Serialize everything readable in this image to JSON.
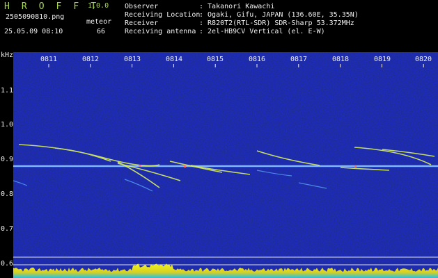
{
  "app": {
    "title": "H R O F F T",
    "version": "1.0.0"
  },
  "file": {
    "name": "2505090810.png",
    "datetime": "25.05.09 08:10"
  },
  "meteor": {
    "label": "meteor",
    "count": "66"
  },
  "info": [
    {
      "label": "Observer",
      "value": ": Takanori Kawachi"
    },
    {
      "label": "Receiving Location",
      "value": ": Ogaki, Gifu, JAPAN (136.60E, 35.35N)"
    },
    {
      "label": "Receiver",
      "value": ": R820T2(RTL-SDR) SDR-Sharp 53.372MHz"
    },
    {
      "label": "Receiving antenna",
      "value": ": 2el-HB9CV Vertical (el. E-W)"
    }
  ],
  "axis": {
    "unit": "kHz",
    "y_labels": [
      "1.1",
      "1.0",
      "0.9",
      "0.8",
      "0.7",
      "0.6"
    ],
    "time_labels": [
      "0811",
      "0812",
      "0813",
      "0814",
      "0815",
      "0816",
      "0817",
      "0818",
      "0819",
      "0820"
    ]
  },
  "colors": {
    "header_green": "#a8d850",
    "background_blue": "#10108a",
    "carrier": "#c8e8ff",
    "meteor_trail": "#d8f060",
    "amplitude": "#f0f020",
    "amplitude_base": "#20c0f0"
  }
}
